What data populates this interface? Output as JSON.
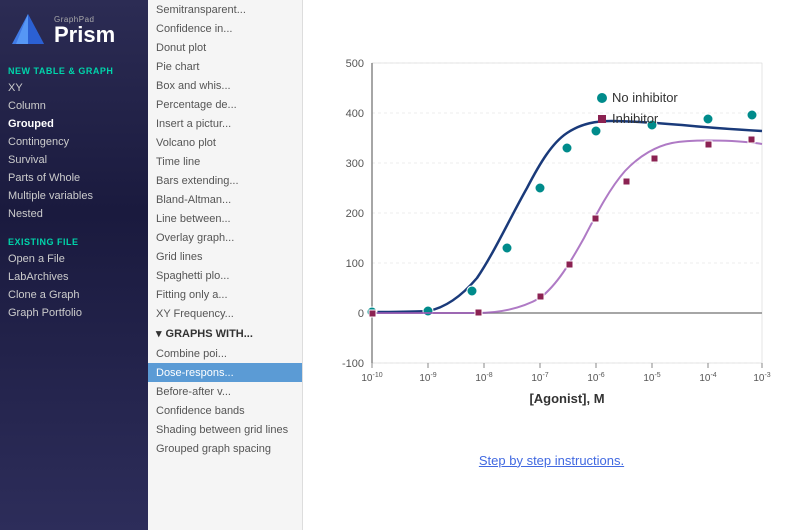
{
  "sidebar": {
    "logo": {
      "graphpad_label": "GraphPad",
      "prism_label": "Prism"
    },
    "new_table_header": "NEW TABLE & GRAPH",
    "new_table_items": [
      {
        "label": "XY"
      },
      {
        "label": "Column"
      },
      {
        "label": "Grouped"
      },
      {
        "label": "Contingency"
      },
      {
        "label": "Survival"
      },
      {
        "label": "Parts of Whole"
      },
      {
        "label": "Multiple variables"
      },
      {
        "label": "Nested"
      }
    ],
    "existing_header": "EXISTING FILE",
    "existing_items": [
      {
        "label": "Open a File"
      },
      {
        "label": "LabArchives"
      },
      {
        "label": "Clone a Graph"
      },
      {
        "label": "Graph Portfolio"
      }
    ]
  },
  "menu": {
    "items": [
      {
        "label": "Semitransparent...",
        "type": "item"
      },
      {
        "label": "Confidence in...",
        "type": "item"
      },
      {
        "label": "Donut plot",
        "type": "item"
      },
      {
        "label": "Pie chart",
        "type": "item"
      },
      {
        "label": "Box and whis...",
        "type": "item"
      },
      {
        "label": "Percentage de...",
        "type": "item"
      },
      {
        "label": "Insert a pictur...",
        "type": "item"
      },
      {
        "label": "Volcano plot",
        "type": "item"
      },
      {
        "label": "Time line",
        "type": "item"
      },
      {
        "label": "Bars extending...",
        "type": "item"
      },
      {
        "label": "Bland-Altman...",
        "type": "item"
      },
      {
        "label": "Line between...",
        "type": "item"
      },
      {
        "label": "Overlay graph...",
        "type": "item"
      },
      {
        "label": "Grid lines",
        "type": "item"
      },
      {
        "label": "Spaghetti plo...",
        "type": "item"
      },
      {
        "label": "Fitting only a...",
        "type": "item"
      },
      {
        "label": "XY Frequency...",
        "type": "item"
      },
      {
        "label": "GRAPHS WITH...",
        "type": "section"
      },
      {
        "label": "Combine poi...",
        "type": "item"
      },
      {
        "label": "Dose-respons...",
        "type": "item",
        "active": true
      },
      {
        "label": "Before-after v...",
        "type": "item"
      },
      {
        "label": "Confidence bands",
        "type": "item"
      },
      {
        "label": "Shading between grid lines",
        "type": "item"
      },
      {
        "label": "Grouped graph spacing",
        "type": "item"
      }
    ]
  },
  "graph": {
    "title": "",
    "x_axis_label": "[Agonist], M",
    "y_axis_max": "500",
    "y_axis_400": "400",
    "y_axis_300": "300",
    "y_axis_200": "200",
    "y_axis_100": "100",
    "y_axis_0": "0",
    "y_axis_neg100": "-100",
    "x_labels": [
      "10⁻¹⁰",
      "10⁻⁹",
      "10⁻⁸",
      "10⁻⁷",
      "10⁻⁶",
      "10⁻⁵",
      "10⁻⁴",
      "10⁻³"
    ],
    "legend": [
      {
        "label": "No inhibitor",
        "color": "#008b8b",
        "shape": "circle"
      },
      {
        "label": "Inhibitor",
        "color": "#8b2252",
        "shape": "square"
      }
    ]
  },
  "step_link": "Step by step instructions."
}
